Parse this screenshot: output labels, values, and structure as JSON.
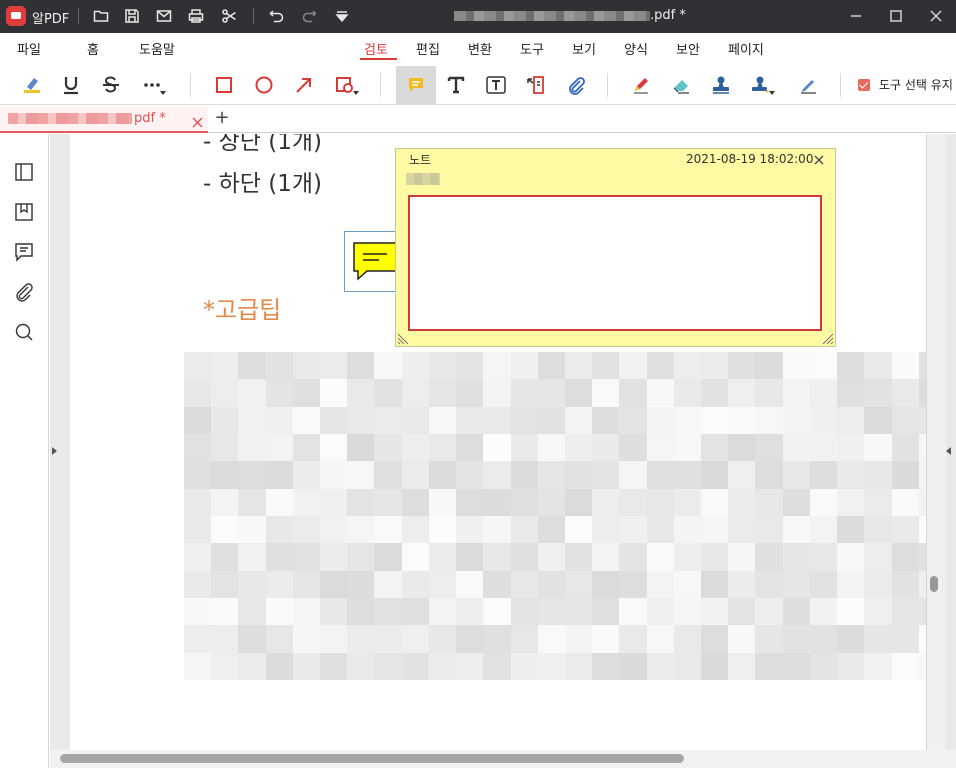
{
  "app": {
    "name": "알PDF"
  },
  "window": {
    "title_suffix": ".pdf *"
  },
  "menu": {
    "items": [
      {
        "label": "파일"
      },
      {
        "label": "홈"
      },
      {
        "label": "도움말"
      },
      {
        "label": "검토",
        "active": true
      },
      {
        "label": "편집"
      },
      {
        "label": "변환"
      },
      {
        "label": "도구"
      },
      {
        "label": "보기"
      },
      {
        "label": "양식"
      },
      {
        "label": "보안"
      },
      {
        "label": "페이지"
      }
    ]
  },
  "toolbar": {
    "tools": [
      "highlight-icon",
      "underline-icon",
      "strikethrough-icon",
      "more-icon",
      "rectangle-icon",
      "ellipse-icon",
      "arrow-icon",
      "shape-icon",
      "note-icon",
      "text-icon",
      "textbox-icon",
      "callout-icon",
      "attachment-icon",
      "pencil-icon",
      "eraser-icon",
      "stamp-icon",
      "stamp-dropdown-icon",
      "signature-pen-icon"
    ],
    "select_tool_label": "도구 선택 유지",
    "select_tool_checked": true
  },
  "tab": {
    "title_suffix": "pdf *",
    "add_label": "+"
  },
  "document": {
    "line_top": "- 상단 (1개)",
    "line_bottom": "- 하단 (1개)",
    "tip": "*고급팁"
  },
  "note_popup": {
    "title": "노트",
    "date": "2021-08-19 18:02:00",
    "content": ""
  },
  "colors": {
    "accent": "#d83a34",
    "titlebar": "#303134",
    "note_bg": "#fefba4",
    "note_icon": "#ffff00",
    "tip_color": "#e08a4b"
  }
}
